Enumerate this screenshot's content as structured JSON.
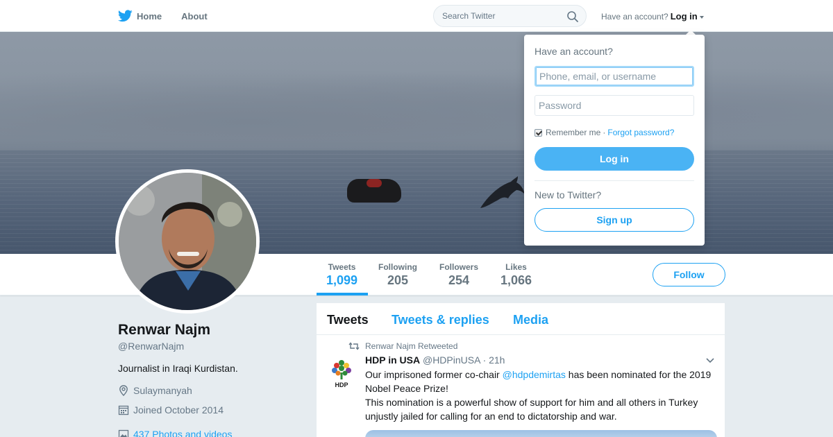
{
  "nav": {
    "home_label": "Home",
    "about_label": "About",
    "search_placeholder": "Search Twitter",
    "account_prompt": "Have an account?",
    "login_label": "Log in"
  },
  "profile": {
    "name": "Renwar Najm",
    "handle": "@RenwarNajm",
    "bio": "Journalist in Iraqi Kurdistan.",
    "location": "Sulaymanyah",
    "joined": "Joined October 2014",
    "photos": "437 Photos and videos",
    "follow_label": "Follow"
  },
  "stats": [
    {
      "label": "Tweets",
      "value": "1,099"
    },
    {
      "label": "Following",
      "value": "205"
    },
    {
      "label": "Followers",
      "value": "254"
    },
    {
      "label": "Likes",
      "value": "1,066"
    }
  ],
  "timeline": {
    "tabs": [
      "Tweets",
      "Tweets & replies",
      "Media"
    ],
    "retweet_line": "Renwar Najm Retweeted",
    "tweet": {
      "author": "HDP in USA",
      "author_handle": "@HDPinUSA",
      "time": "· 21h",
      "logo_text": "HDP",
      "text_before": "Our imprisoned former co-chair ",
      "mention": "@hdpdemirtas",
      "text_after": " has been nominated for the 2019 Nobel Peace Prize!",
      "text_second": "This nomination is a powerful show of support for him and all others in Turkey unjustly jailed for calling for an end to dictatorship and war."
    }
  },
  "login_dropdown": {
    "title": "Have an account?",
    "username_placeholder": "Phone, email, or username",
    "password_placeholder": "Password",
    "remember_label": "Remember me",
    "separator": "·",
    "forgot_label": "Forgot password?",
    "login_button": "Log in",
    "new_prompt": "New to Twitter?",
    "signup_button": "Sign up"
  },
  "colors": {
    "accent": "#1da1f2",
    "login_button": "#4ab3f4",
    "background": "#e6ecf0"
  }
}
